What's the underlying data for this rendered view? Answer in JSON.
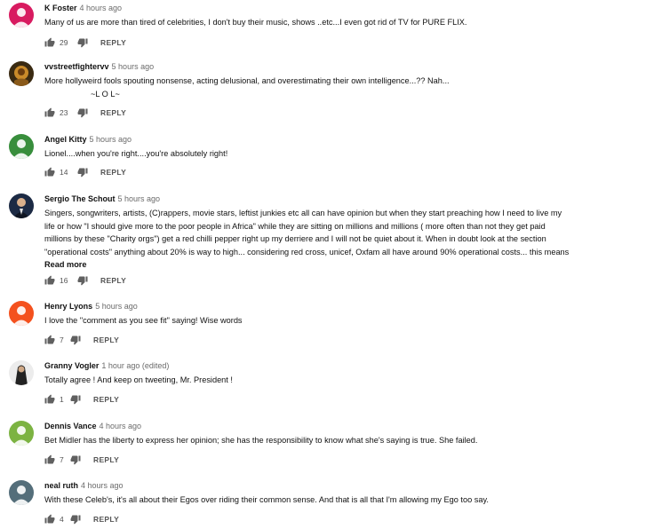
{
  "comments": [
    {
      "author": "K Foster",
      "time": "4 hours ago",
      "lines": [
        "Many of us are more than tired of celebrities,  I don't buy their music, shows ..etc...I even got rid of TV for PURE FLIX."
      ],
      "likes": "29",
      "reply": "REPLY",
      "avatar_color": "#d81b60"
    },
    {
      "author": "vvstreetfightervv",
      "time": "5 hours ago",
      "lines": [
        "More hollyweird fools spouting nonsense, acting delusional, and overestimating their own intelligence...??  Nah..."
      ],
      "extra_line": "~L O L~",
      "likes": "23",
      "reply": "REPLY",
      "avatar_color": "#3a2a12"
    },
    {
      "author": "Angel Kitty",
      "time": "5 hours ago",
      "lines": [
        "Lionel....when you're right....you're absolutely right!"
      ],
      "likes": "14",
      "reply": "REPLY",
      "avatar_color": "#388e3c"
    },
    {
      "author": "Sergio The Schout",
      "time": "5 hours ago",
      "lines": [
        "Singers, songwriters, artists, (C)rappers, movie stars, leftist junkies etc all can have opinion but when they start preaching how I need to live my",
        "life or how \"I should give more to the poor people in Africa\" while they are sitting on millions and millions ( more often than not they get paid",
        "millions by these \"Charity orgs\") get a red chilli pepper right up my derriere and I will not be quiet about it. When in doubt look at the section",
        "\"operational costs\" anything about 20% is way to high... considering red cross, unicef, Oxfam all have around 90% operational costs... this means"
      ],
      "read_more": "Read more",
      "likes": "16",
      "reply": "REPLY",
      "avatar_color": "#1c2a44"
    },
    {
      "author": "Henry Lyons",
      "time": "5 hours ago",
      "lines": [
        "I love the \"comment as you see fit\" saying! Wise words"
      ],
      "likes": "7",
      "reply": "REPLY",
      "avatar_color": "#f4511e"
    },
    {
      "author": "Granny Vogler",
      "time": "1 hour ago (edited)",
      "lines": [
        "Totally agree !   And keep on tweeting, Mr. President !"
      ],
      "likes": "1",
      "reply": "REPLY",
      "avatar_color": "#222222"
    },
    {
      "author": "Dennis Vance",
      "time": "4 hours ago",
      "lines": [
        "Bet Midler has the liberty to express her opinion; she has the responsibility to know what she's saying is true. She failed."
      ],
      "likes": "7",
      "reply": "REPLY",
      "avatar_color": "#7cb342"
    },
    {
      "author": "neal ruth",
      "time": "4 hours ago",
      "lines": [
        "With these Celeb's, it's all about their Egos over riding their common sense.  And that is all that I'm allowing my Ego too say."
      ],
      "likes": "4",
      "reply": "REPLY",
      "avatar_color": "#546e7a"
    }
  ],
  "icons": {
    "like": "thumbs-up-icon",
    "dislike": "thumbs-down-icon",
    "action_color": "#606060"
  }
}
